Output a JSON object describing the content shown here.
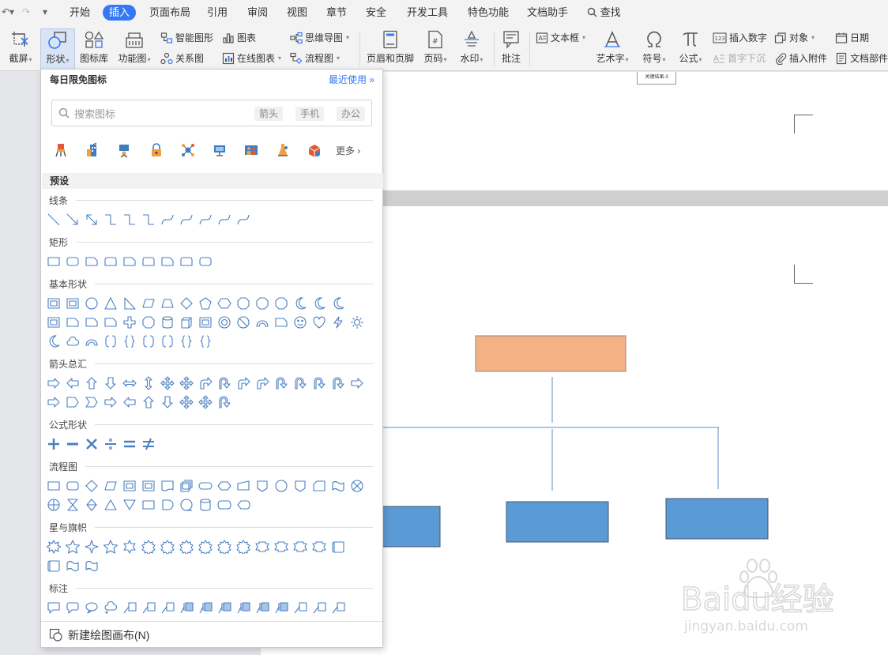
{
  "menubar": {
    "tabs": [
      "开始",
      "插入",
      "页面布局",
      "引用",
      "审阅",
      "视图",
      "章节",
      "安全",
      "开发工具",
      "特色功能",
      "文档助手"
    ],
    "active_tab": "插入",
    "search_label": "查找"
  },
  "ribbon": {
    "screenshot": "截屏",
    "shapes": "形状",
    "icon_library": "图标库",
    "function_chart": "功能图",
    "smart_graphic": "智能图形",
    "chart": "图表",
    "relation_graph": "关系图",
    "online_chart": "在线图表",
    "mind_map": "思维导图",
    "flowchart": "流程图",
    "header_footer": "页眉和页脚",
    "page_number": "页码",
    "watermark": "水印",
    "comment": "批注",
    "text_box": "文本框",
    "word_art": "艺术字",
    "symbol": "符号",
    "formula": "公式",
    "insert_number": "插入数字",
    "drop_cap": "首字下沉",
    "object": "对象",
    "insert_attachment": "插入附件",
    "date": "日期",
    "doc_parts": "文档部件"
  },
  "document": {
    "caption": "关键结果-3"
  },
  "shapes_panel": {
    "header": "每日限免图标",
    "recent": "最近使用",
    "search_placeholder": "搜索图标",
    "tags": [
      "箭头",
      "手机",
      "办公"
    ],
    "more": "更多",
    "preset": "预设",
    "sections": {
      "lines": "线条",
      "rect": "矩形",
      "basic": "基本形状",
      "arrows": "箭头总汇",
      "formula": "公式形状",
      "flowchart": "流程图",
      "stars": "星与旗帜",
      "callouts": "标注"
    },
    "new_canvas": "新建绘图画布(N)"
  },
  "watermark": {
    "brand": "Baidu经验",
    "url": "jingyan.baidu.com"
  },
  "colors": {
    "accent": "#3478f6",
    "shape_orange": "#f4b183",
    "shape_blue": "#5b9bd5",
    "icon_outline": "#4a7fc1"
  }
}
